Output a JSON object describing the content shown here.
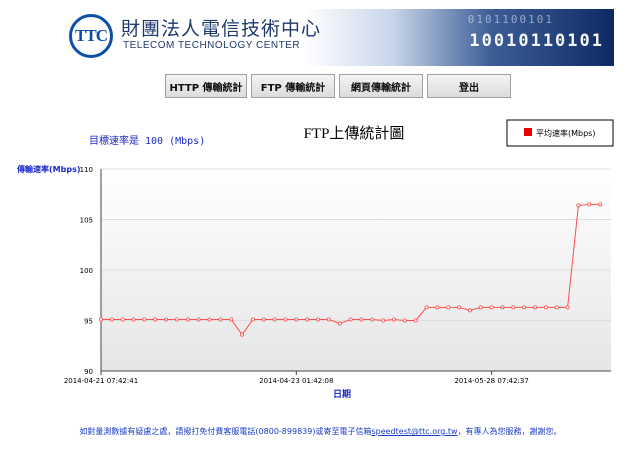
{
  "header": {
    "logo_text": "TTC",
    "org_name_zh": "財團法人電信技術中心",
    "org_name_en": "TELECOM TECHNOLOGY CENTER",
    "banner_digits": "10010110101",
    "banner_digits_faint": "0101100101"
  },
  "nav": {
    "items": [
      {
        "label": "HTTP 傳輸統計"
      },
      {
        "label": "FTP 傳輸統計"
      },
      {
        "label": "網頁傳輸統計"
      },
      {
        "label": "登出"
      }
    ]
  },
  "colors": {
    "series_line": "#ff4d4d",
    "legend_swatch": "#e60000",
    "axis_text_blue": "#1a28c8",
    "grid": "#dddddd",
    "plot_bg_bottom": "#e8e8e8"
  },
  "chart_data": {
    "type": "line",
    "title": "FTP上傳統計圖",
    "subtitle": "目標速率是 100 (Mbps)",
    "ylabel": "傳輸速率(Mbps)",
    "xlabel": "日期",
    "ylim": [
      90,
      110
    ],
    "y_ticks": [
      90,
      95,
      100,
      105,
      110
    ],
    "x_tick_labels": [
      "2014-04-21 07:42:41",
      "2014-04-23 01:42:08",
      "2014-05-28 07:42:37"
    ],
    "x_tick_indices": [
      0,
      18,
      36
    ],
    "legend": {
      "label": "平均速率(Mbps)",
      "position": "top-right"
    },
    "grid": true,
    "series": [
      {
        "name": "平均速率(Mbps)",
        "values": [
          95.1,
          95.1,
          95.1,
          95.1,
          95.1,
          95.1,
          95.1,
          95.1,
          95.1,
          95.1,
          95.1,
          95.1,
          95.1,
          93.6,
          95.1,
          95.1,
          95.1,
          95.1,
          95.1,
          95.1,
          95.1,
          95.1,
          94.7,
          95.1,
          95.1,
          95.1,
          95.0,
          95.1,
          95.0,
          95.0,
          96.3,
          96.3,
          96.3,
          96.3,
          96.0,
          96.3,
          96.3,
          96.3,
          96.3,
          96.3,
          96.3,
          96.3,
          96.3,
          96.3,
          106.4,
          106.5,
          106.5
        ]
      }
    ]
  },
  "footer": {
    "text_before": "如對量測數據有疑慮之處，請撥打免付費客服電話(0800-899839)或寄至電子信箱",
    "email": "speedtest@ttc.org.tw",
    "text_after": "，有專人為您服務，謝謝您。"
  }
}
